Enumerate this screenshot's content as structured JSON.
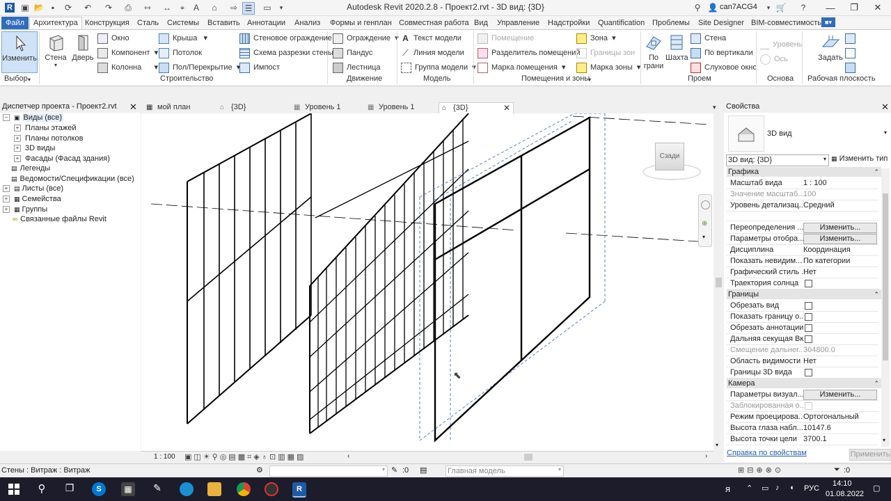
{
  "title_bar": {
    "title": "Autodesk Revit 2020.2.8 - Проект2.rvt - 3D вид: {3D}",
    "user": "can7ACG4"
  },
  "ribbon_tabs": [
    "Файл",
    "Архитектура",
    "Конструкция",
    "Сталь",
    "Системы",
    "Вставить",
    "Аннотации",
    "Анализ",
    "Формы и генплан",
    "Совместная работа",
    "Вид",
    "Управление",
    "Надстройки",
    "Quantification",
    "Проблемы",
    "Site Designer",
    "BIM-совместимость"
  ],
  "ribbon": {
    "select": {
      "modify": "Изменить",
      "label": "Выбор"
    },
    "build": {
      "wall": "Стена",
      "door": "Дверь",
      "window": "Окно",
      "component": "Компонент",
      "column": "Колонна",
      "roof": "Крыша",
      "ceiling": "Потолок",
      "floor": "Пол/Перекрытие",
      "curtain_system": "Стеновое ограждение",
      "curtain_grid": "Схема разрезки стены",
      "mullion": "Импост",
      "label": "Строительство"
    },
    "circulation": {
      "railing": "Ограждение",
      "ramp": "Пандус",
      "stair": "Лестница",
      "label": "Движение"
    },
    "model": {
      "model_text": "Текст модели",
      "model_line": "Линия модели",
      "model_group": "Группа модели",
      "label": "Модель"
    },
    "room": {
      "room": "Помещение",
      "room_separator": "Разделитель помещений",
      "room_tag": "Марка помещения",
      "area": "Зона",
      "area_boundary": "Границы зон",
      "area_tag": "Марка зоны",
      "label": "Помещения и зоны"
    },
    "opening": {
      "by_face": "По грани",
      "shaft": "Шахта",
      "wall": "Стена",
      "vertical": "По вертикали",
      "dormer": "Слуховое окно",
      "label": "Проем"
    },
    "datum": {
      "level": "Уровень",
      "grid": "Ось",
      "label": "Основа"
    },
    "workplane": {
      "set": "Задать",
      "label": "Рабочая плоскость"
    }
  },
  "project_browser": {
    "title": "Диспетчер проекта - Проект2.rvt",
    "items": [
      "Виды (все)",
      "Планы этажей",
      "Планы потолков",
      "3D виды",
      "Фасады (Фасад здания)",
      "Легенды",
      "Ведомости/Спецификации (все)",
      "Листы (все)",
      "Семейства",
      "Группы",
      "Связанные файлы Revit"
    ]
  },
  "doc_tabs": [
    "мой план",
    "{3D}",
    "Уровень 1",
    "Уровень 1",
    "{3D}"
  ],
  "viewcube": {
    "face": "Сзади"
  },
  "view_bar": {
    "scale": "1 : 100"
  },
  "properties": {
    "title": "Свойства",
    "type_name": "3D вид",
    "selector": "3D вид: {3D}",
    "edit_type": "Изменить тип",
    "groups": {
      "graphics": "Графика",
      "extents": "Границы",
      "camera": "Камера"
    },
    "rows": [
      {
        "k": "Масштаб вида",
        "v": "1 : 100"
      },
      {
        "k": "Значение масштаб...",
        "v": "100"
      },
      {
        "k": "Уровень детализац...",
        "v": "Средний"
      },
      {
        "k": "Переопределения ...",
        "v": "Изменить..."
      },
      {
        "k": "Параметры отобра...",
        "v": "Изменить..."
      },
      {
        "k": "Дисциплина",
        "v": "Координация"
      },
      {
        "k": "Показать невидим...",
        "v": "По категории"
      },
      {
        "k": "Графический стиль ...",
        "v": "Нет"
      },
      {
        "k": "Траектория солнца",
        "v": ""
      },
      {
        "k": "Обрезать вид",
        "v": ""
      },
      {
        "k": "Показать границу о...",
        "v": ""
      },
      {
        "k": "Обрезать аннотации",
        "v": ""
      },
      {
        "k": "Дальняя секущая Вкл",
        "v": ""
      },
      {
        "k": "Смещение дальнег...",
        "v": "304800.0"
      },
      {
        "k": "Область видимости",
        "v": "Нет"
      },
      {
        "k": "Границы 3D вида",
        "v": ""
      },
      {
        "k": "Параметры визуал...",
        "v": "Изменить..."
      },
      {
        "k": "Заблокированная о...",
        "v": ""
      },
      {
        "k": "Режим проецирова...",
        "v": "Ортогональный"
      },
      {
        "k": "Высота глаза набл...",
        "v": "10147.6"
      },
      {
        "k": "Высота точки цели",
        "v": "3700.1"
      }
    ],
    "help_link": "Справка по свойствам",
    "apply": "Применить"
  },
  "status_bar": {
    "text": "Стены : Витраж : Витраж",
    "count1": ":0",
    "model": "Главная модель",
    "count2": ":0"
  },
  "taskbar": {
    "lang": "РУС",
    "time": "14:10",
    "date": "01.08.2022"
  },
  "colors": {
    "accent": "#2f6cbe",
    "taskbar": "#1c1c2b"
  }
}
